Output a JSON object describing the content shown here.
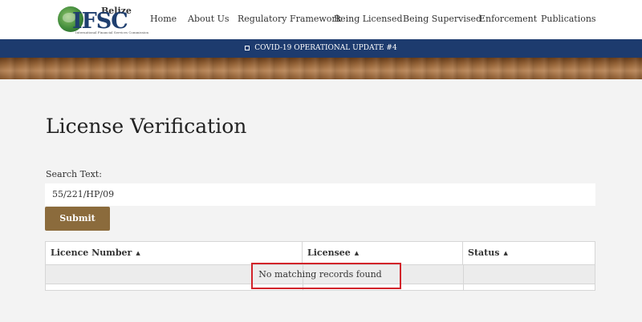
{
  "header": {
    "logo": {
      "region": "Belize",
      "acronym": "IFSC",
      "tagline": "International Financial Services Commission"
    },
    "nav": [
      {
        "label": "Home"
      },
      {
        "label": "About Us"
      },
      {
        "label": "Regulatory Framework"
      },
      {
        "label": "Being Licensed"
      },
      {
        "label": "Being Supervised"
      },
      {
        "label": "Enforcement"
      },
      {
        "label": "Publications"
      }
    ]
  },
  "announcement": {
    "text": "COVID-19 OPERATIONAL UPDATE #4"
  },
  "main": {
    "title": "License Verification",
    "search": {
      "label": "Search Text:",
      "value": "55/221/HP/09"
    },
    "submit_label": "Submit",
    "table": {
      "columns": [
        {
          "label": "Licence Number",
          "sort_icon": "sort-up-icon"
        },
        {
          "label": "Licensee",
          "sort_icon": "sort-up-icon"
        },
        {
          "label": "Status",
          "sort_icon": "sort-up-icon"
        }
      ],
      "empty_message": "No matching records found"
    }
  },
  "colors": {
    "nav_bar": "#1d3b6e",
    "submit_button": "#8b6b3c",
    "highlight_box": "#d2232a"
  }
}
